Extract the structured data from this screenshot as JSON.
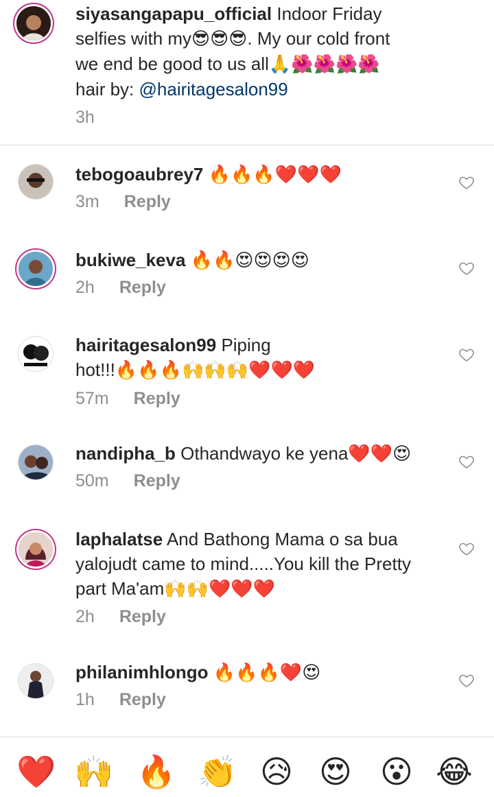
{
  "caption": {
    "username": "siyasangapapu_official",
    "text_line1": "Indoor Friday",
    "text_line2": "selfies with my",
    "emoji_line2": "😎😎😎",
    "text_line2b": ". My our cold front",
    "text_line3": "we end be good to us all",
    "emoji_line3": "🙏🌺🌺🌺🌺",
    "text_line4": "hair by: ",
    "link": "@hairitagesalon99",
    "time": "3h"
  },
  "comments": [
    {
      "username": "tebogoaubrey7",
      "text": "",
      "emoji": "🔥🔥🔥❤️❤️❤️",
      "time": "3m",
      "reply": "Reply"
    },
    {
      "username": "bukiwe_keva",
      "text": "",
      "emoji": "🔥🔥😍😍😍😍",
      "time": "2h",
      "reply": "Reply"
    },
    {
      "username": "hairitagesalon99",
      "text": "Piping",
      "text2": "hot!!!",
      "emoji": "🔥🔥🔥🙌🙌🙌❤️❤️❤️",
      "time": "57m",
      "reply": "Reply"
    },
    {
      "username": "nandipha_b",
      "text": "Othandwayo ke yena",
      "emoji": "❤️❤️😍",
      "time": "50m",
      "reply": "Reply"
    },
    {
      "username": "laphalatse",
      "text": "And Bathong Mama o sa bua",
      "text2": "yalojudt came to mind.....You kill the Pretty",
      "text3": "part Ma'am",
      "emoji": "🙌🙌❤️❤️❤️",
      "time": "2h",
      "reply": "Reply"
    },
    {
      "username": "philanimhlongo",
      "text": "",
      "emoji": "🔥🔥🔥❤️😍",
      "time": "1h",
      "reply": "Reply"
    }
  ],
  "reactions": [
    "❤️",
    "🙌",
    "🔥",
    "👏",
    "😥",
    "😍",
    "😮",
    "😂"
  ],
  "icons": {
    "like": "heart-outline-icon"
  },
  "colors": {
    "ring": "#c13584",
    "meta": "#8e8e8e",
    "link": "#00376b"
  }
}
